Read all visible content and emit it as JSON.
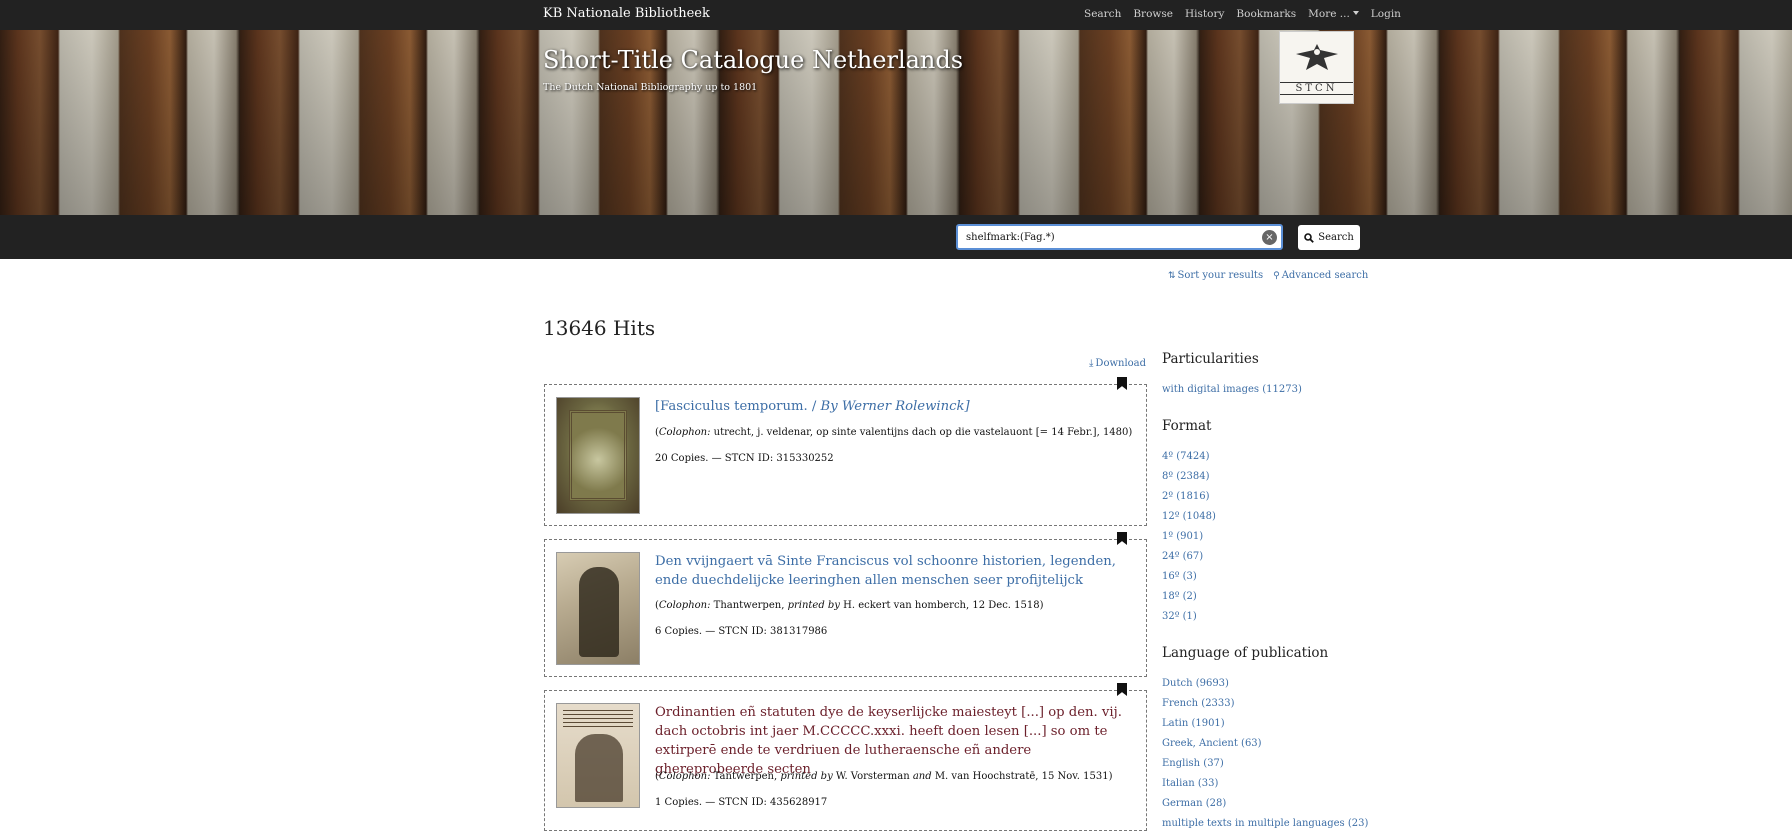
{
  "nav": {
    "brand": "KB Nationale Bibliotheek",
    "links": [
      "Search",
      "Browse",
      "History",
      "Bookmarks",
      "More ...",
      "Login"
    ]
  },
  "banner": {
    "title": "Short-Title Catalogue Netherlands",
    "subtitle": "The Dutch National Bibliography up to 1801",
    "logo_text": "STCN"
  },
  "search": {
    "value": "shelfmark:(Fag.*)",
    "button_label": "Search",
    "clear_icon": "close-icon"
  },
  "tools": {
    "sort_label": "Sort your results",
    "advanced_label": "Advanced search"
  },
  "results_header": {
    "hits": "13646 Hits",
    "download_label": "Download"
  },
  "results": [
    {
      "title_main": "[Fasciculus temporum. / ",
      "title_author": "By Werner Rolewinck]",
      "colophon_label": "Colophon:",
      "colophon_text": " utrecht, j. veldenar, op sinte valentijns dach op die vastelauont [= 14 Febr.], 1480)",
      "copies": "20 Copies. — STCN ID: 315330252",
      "visited": false
    },
    {
      "title_main": "Den vvijngaert vā Sinte Franciscus vol schoonre historien, legenden, ende duechdelijcke leeringhen allen menschen seer profijtelijck",
      "colophon_label": "Colophon:",
      "colophon_place": " Thantwerpen, ",
      "printed_by": "printed by",
      "colophon_rest": " H. eckert van homberch, 12 Dec. 1518)",
      "copies": "6 Copies. — STCN ID: 381317986",
      "visited": false
    },
    {
      "title_main": "Ordinantien eñ statuten dye de keyserlijcke maiesteyt [...] op den. vij. dach octobris int jaer M.CCCCC.xxxi. heeft doen lesen [...] so om te extirperē ende te verdriuen de lutheraensche eñ andere ghereprobeerde secten",
      "colophon_label": "Colophon:",
      "colophon_place": " Tantwerpen, ",
      "printed_by": "printed by",
      "colophon_p1": " W. Vorsterman ",
      "and": "and",
      "colophon_p2": " M. van Hoochstratē, 15 Nov. 1531)",
      "copies": "1 Copies. — STCN ID: 435628917",
      "visited": true
    }
  ],
  "facets": {
    "particularities": {
      "heading": "Particularities",
      "items": [
        "with digital images (11273)"
      ]
    },
    "format": {
      "heading": "Format",
      "items": [
        "4º (7424)",
        "8º (2384)",
        "2º (1816)",
        "12º (1048)",
        "1º (901)",
        "24º (67)",
        "16º (3)",
        "18º (2)",
        "32º (1)"
      ]
    },
    "language": {
      "heading": "Language of publication",
      "items": [
        "Dutch (9693)",
        "French (2333)",
        "Latin (1901)",
        "Greek, Ancient (63)",
        "English (37)",
        "Italian (33)",
        "German (28)",
        "multiple texts in multiple languages (23)"
      ]
    }
  },
  "colors": {
    "nav_bg": "#222222",
    "link": "#3d6ea6",
    "visited_link": "#6b1f2a",
    "search_border": "#5b8fd6"
  }
}
